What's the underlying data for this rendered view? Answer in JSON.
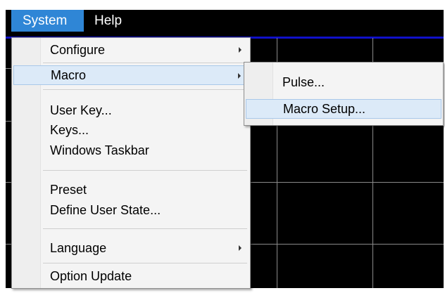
{
  "menubar": {
    "items": [
      {
        "label": "System",
        "active": true
      },
      {
        "label": "Help",
        "active": false
      }
    ]
  },
  "system_menu": {
    "items": [
      {
        "label": "Configure",
        "submenu": true
      },
      {
        "label": "Macro",
        "submenu": true,
        "highlighted": true
      },
      {
        "label": "User Key..."
      },
      {
        "label": "Keys..."
      },
      {
        "label": "Windows Taskbar"
      },
      {
        "label": "Preset"
      },
      {
        "label": "Define User State..."
      },
      {
        "label": "Language",
        "submenu": true
      },
      {
        "label": "Option Update"
      }
    ]
  },
  "macro_submenu": {
    "items": [
      {
        "label": "Pulse..."
      },
      {
        "label": "Macro Setup...",
        "highlighted": true
      }
    ]
  },
  "colors": {
    "menubar_background": "#000000",
    "menubar_active": "#2f86d6",
    "menu_background": "#f4f4f4",
    "highlight": "#dceaf8",
    "display_background": "#000000",
    "grid": "#8a8a8a",
    "accent_line": "#1010c8"
  }
}
